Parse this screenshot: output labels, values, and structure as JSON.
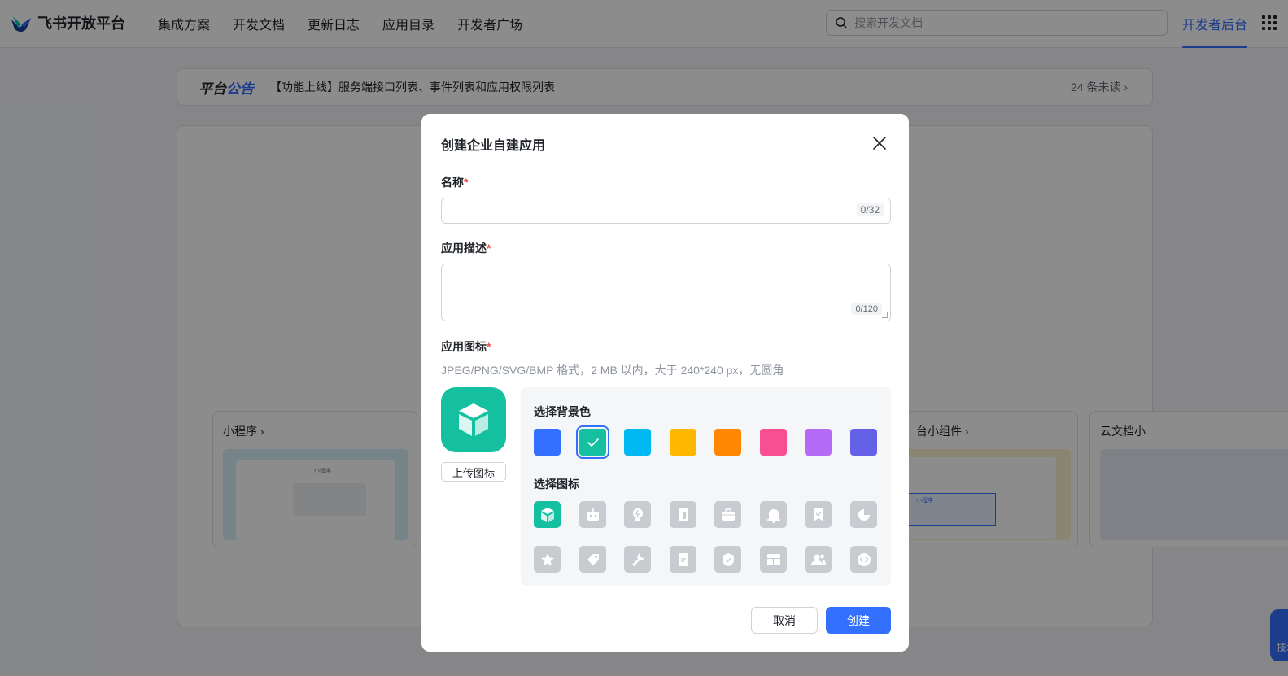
{
  "topbar": {
    "brand": "飞书开放平台",
    "nav": [
      "集成方案",
      "开发文档",
      "更新日志",
      "应用目录",
      "开发者广场"
    ],
    "search_placeholder": "搜索开发文档",
    "console": "开发者后台",
    "apps_icon": "grid-icon"
  },
  "notice": {
    "title_prefix": "平台",
    "title_suffix": "公告",
    "text": "【功能上线】服务端接口列表、事件列表和应用权限列表",
    "unread": "24 条未读 ›"
  },
  "cards": {
    "miniprogram": "小程序 ›",
    "widget": "台小组件 ›",
    "doc": "云文档小",
    "preview_title": "小程序",
    "preview_row": "小程序"
  },
  "dialog": {
    "title": "创建企业自建应用",
    "name_label": "名称",
    "name_value": "",
    "name_counter": "0/32",
    "desc_label": "应用描述",
    "desc_value": "",
    "desc_counter": "0/120",
    "icon_label": "应用图标",
    "required_mark": "*",
    "icon_hint": "JPEG/PNG/SVG/BMP 格式，2 MB 以内，大于 240*240 px，无圆角",
    "upload_label": "上传图标",
    "bg_label": "选择背景色",
    "icon_pick_label": "选择图标",
    "bg_colors": [
      "#3370ff",
      "#14c0a0",
      "#00b9f2",
      "#ffb800",
      "#ff8800",
      "#f74f91",
      "#b46bf6",
      "#6561e7"
    ],
    "selected_bg_index": 1,
    "icons": [
      "cube-icon",
      "robot-icon",
      "lightbulb-icon",
      "book-icon",
      "briefcase-icon",
      "bell-icon",
      "bookmark-check-icon",
      "pie-chart-icon",
      "star-icon",
      "tag-icon",
      "wrench-icon",
      "document-icon",
      "shield-check-icon",
      "layout-icon",
      "users-icon",
      "code-icon"
    ],
    "selected_icon_index": 0,
    "cancel_label": "取消",
    "create_label": "创建"
  },
  "float_support": "技术"
}
